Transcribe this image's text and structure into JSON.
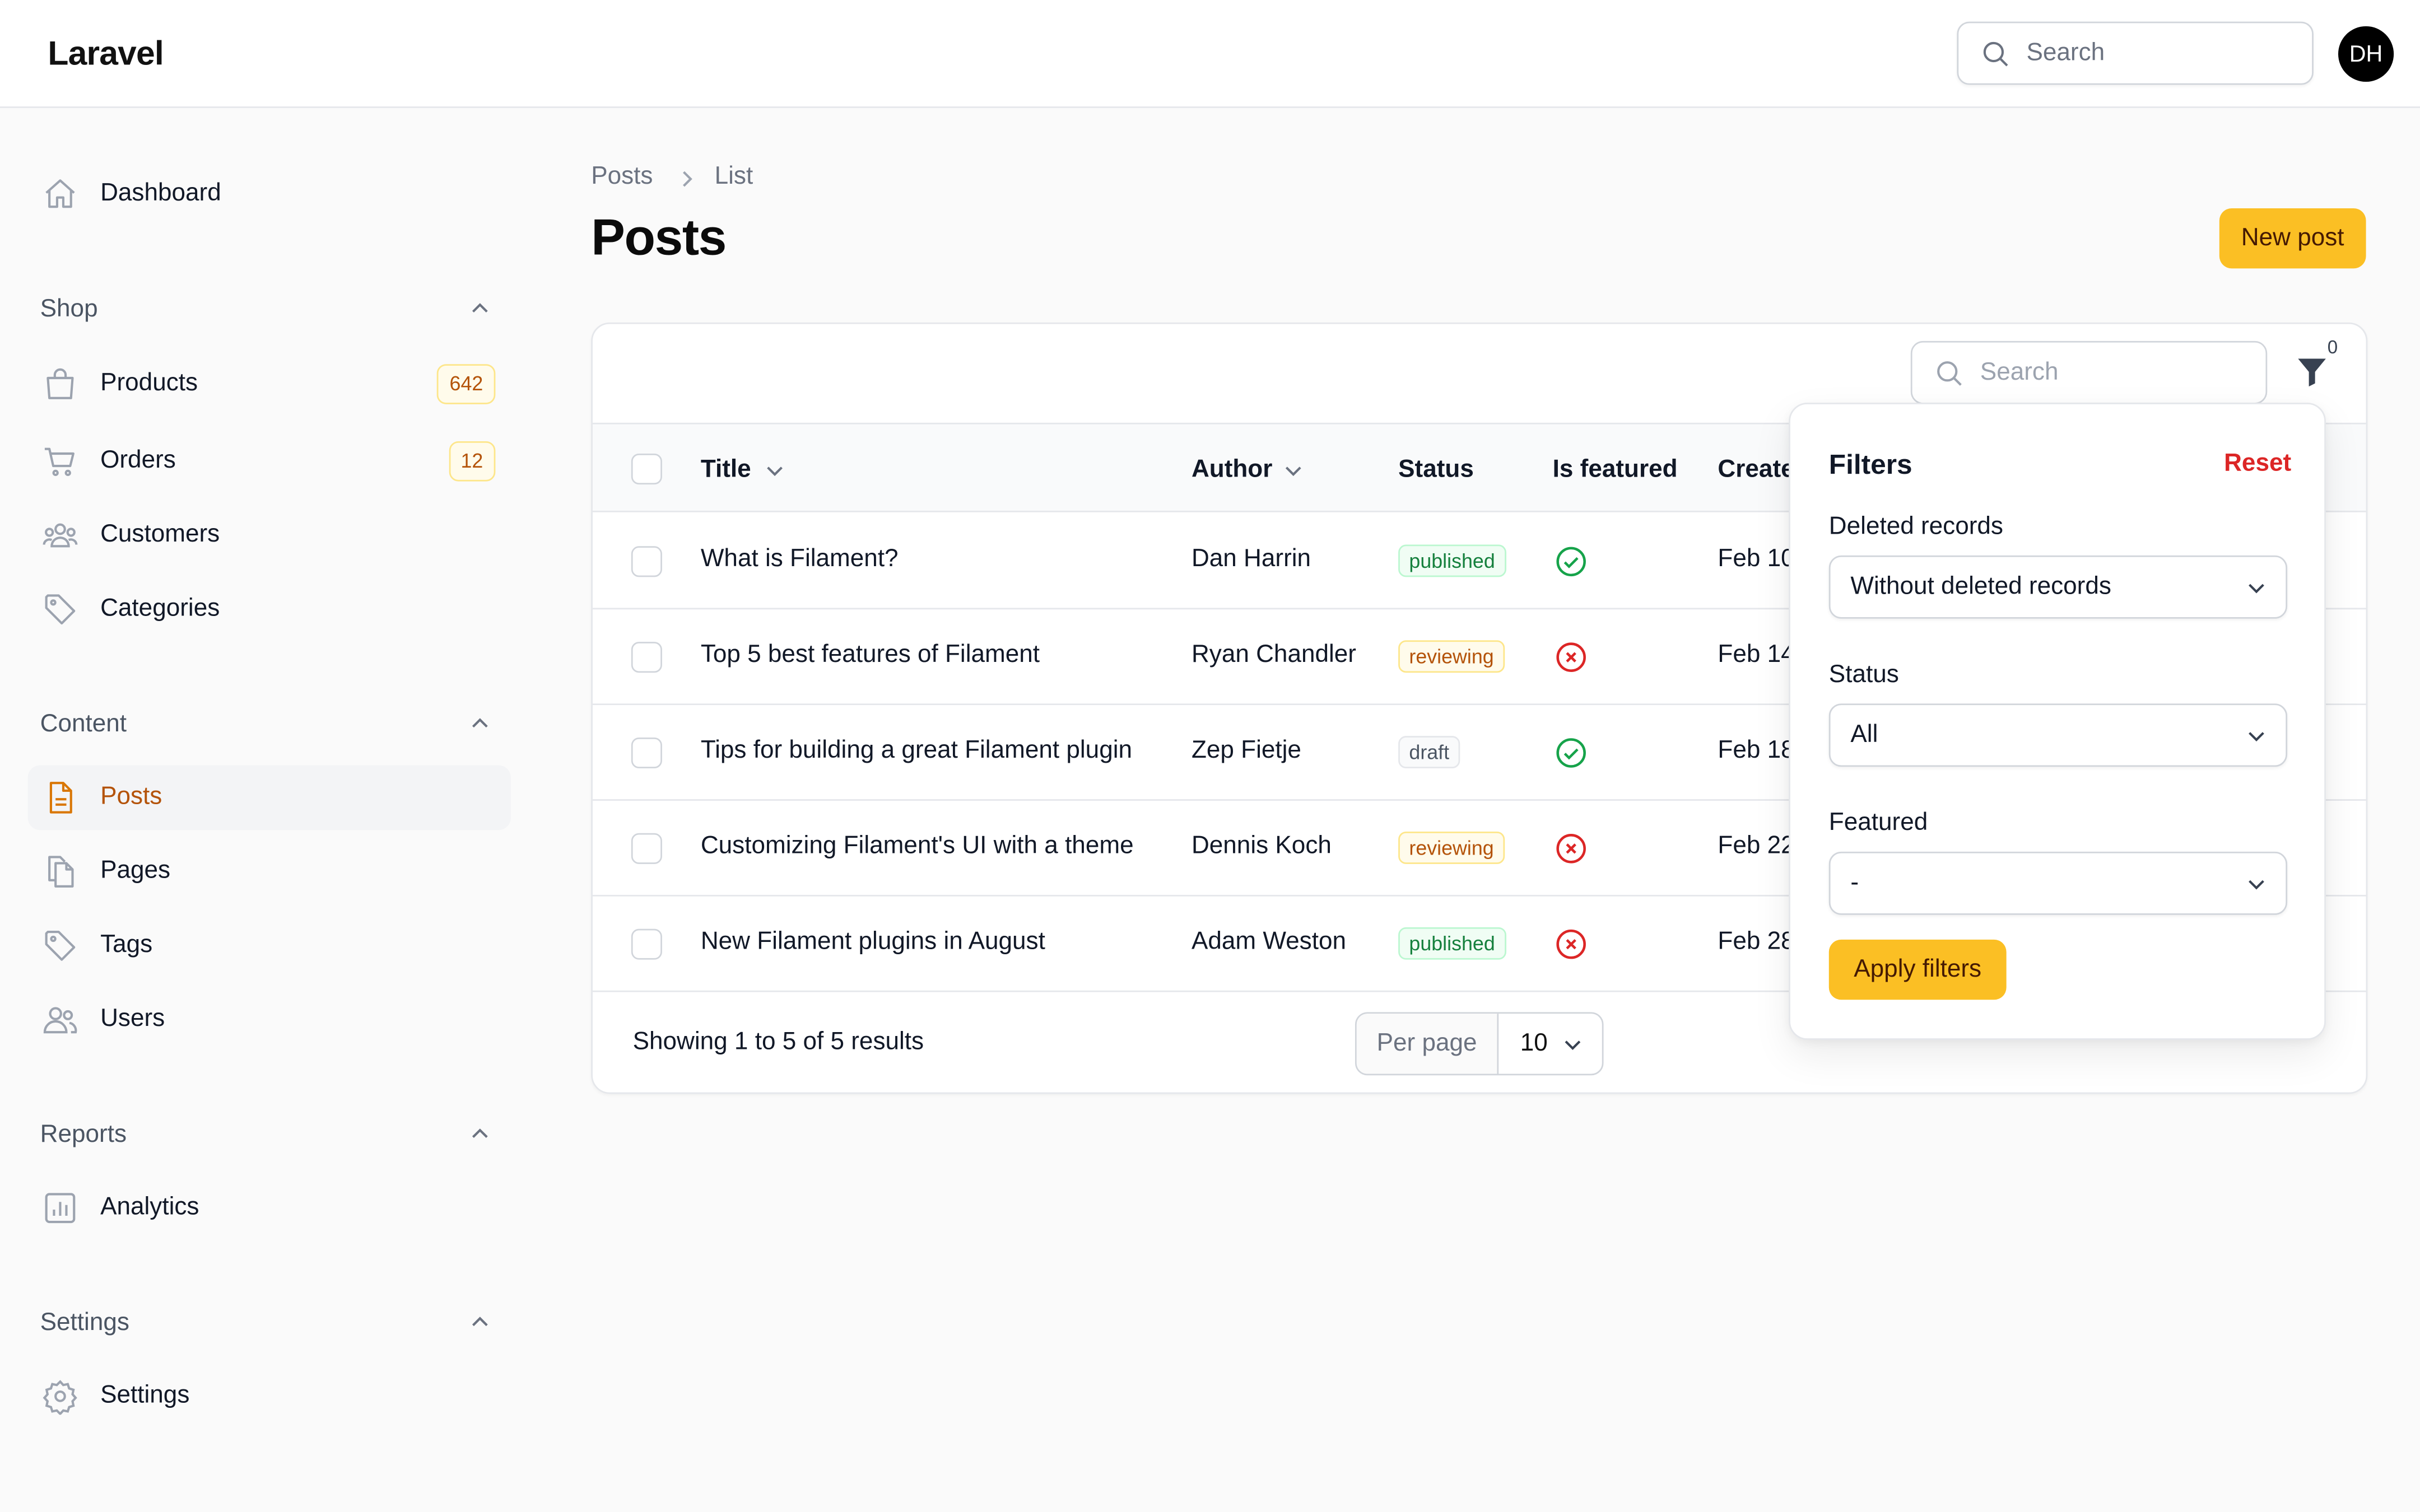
{
  "app": {
    "brand": "Laravel",
    "search_placeholder": "Search",
    "avatar_initials": "DH"
  },
  "sidebar": {
    "dashboard": "Dashboard",
    "groups": {
      "shop": "Shop",
      "content": "Content",
      "reports": "Reports",
      "settings": "Settings"
    },
    "items": {
      "products": {
        "label": "Products",
        "badge": "642"
      },
      "orders": {
        "label": "Orders",
        "badge": "12"
      },
      "customers": {
        "label": "Customers"
      },
      "categories": {
        "label": "Categories"
      },
      "posts": {
        "label": "Posts",
        "active": true
      },
      "pages": {
        "label": "Pages"
      },
      "tags": {
        "label": "Tags"
      },
      "users": {
        "label": "Users"
      },
      "analytics": {
        "label": "Analytics"
      },
      "settings": {
        "label": "Settings"
      }
    }
  },
  "breadcrumb": {
    "parent": "Posts",
    "current": "List"
  },
  "page": {
    "title": "Posts",
    "new_button": "New post"
  },
  "table": {
    "search_placeholder": "Search",
    "filter_count": "0",
    "columns": {
      "title": "Title",
      "author": "Author",
      "status": "Status",
      "featured": "Is featured",
      "created": "Create"
    },
    "rows": [
      {
        "title": "What is Filament?",
        "author": "Dan Harrin",
        "status": "published",
        "featured": true,
        "created": "Feb 10"
      },
      {
        "title": "Top 5 best features of Filament",
        "author": "Ryan Chandler",
        "status": "reviewing",
        "featured": false,
        "created": "Feb 14"
      },
      {
        "title": "Tips for building a great Filament plugin",
        "author": "Zep Fietje",
        "status": "draft",
        "featured": true,
        "created": "Feb 18"
      },
      {
        "title": "Customizing Filament's UI with a theme",
        "author": "Dennis Koch",
        "status": "reviewing",
        "featured": false,
        "created": "Feb 22"
      },
      {
        "title": "New Filament plugins in August",
        "author": "Adam Weston",
        "status": "published",
        "featured": false,
        "created": "Feb 28"
      }
    ],
    "footer": {
      "summary": "Showing 1 to 5 of 5 results",
      "per_page_label": "Per page",
      "per_page_value": "10"
    }
  },
  "filters": {
    "heading": "Filters",
    "reset": "Reset",
    "deleted_label": "Deleted records",
    "deleted_value": "Without deleted records",
    "status_label": "Status",
    "status_value": "All",
    "featured_label": "Featured",
    "featured_value": "-",
    "apply": "Apply filters"
  },
  "colors": {
    "accent": "#fbbf24",
    "active_text": "#b45309",
    "success": "#16a34a",
    "danger": "#dc2626"
  }
}
